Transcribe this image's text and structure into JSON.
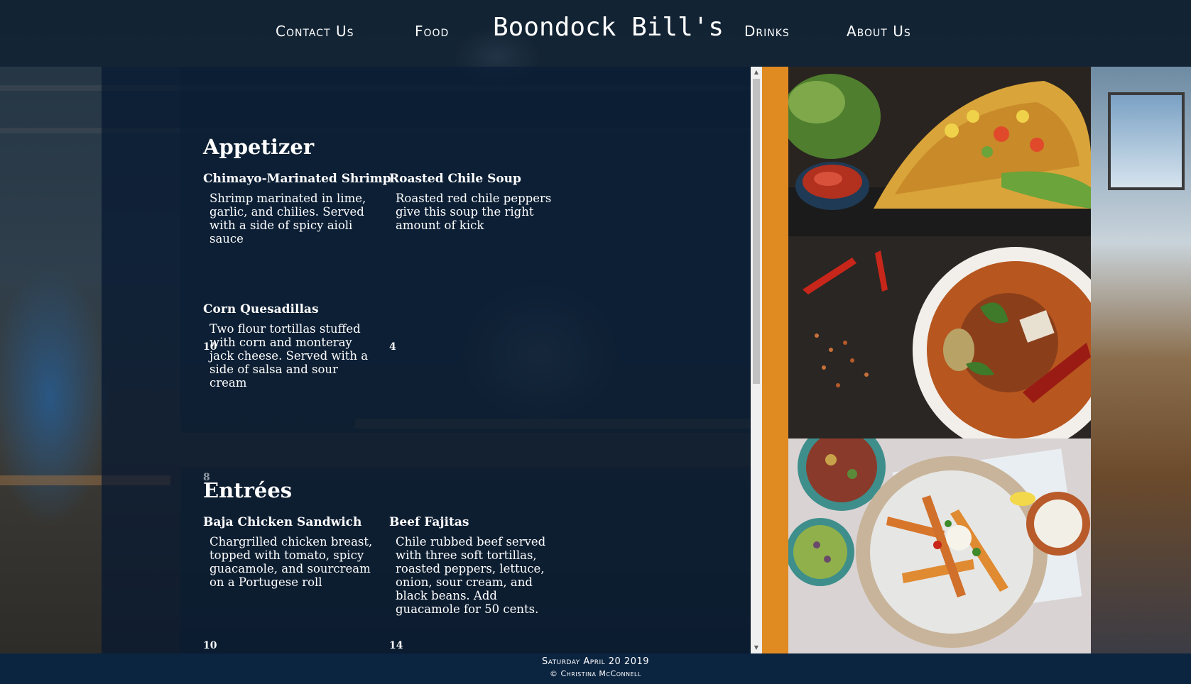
{
  "nav": {
    "contact_label": "Contact Us",
    "food_label": "Food",
    "brand": "Boondock Bill's",
    "drinks_label": "Drinks",
    "about_label": "About Us"
  },
  "menu": {
    "sections": [
      {
        "title": "Appetizer",
        "items": [
          {
            "name": "Chimayo-Marinated Shrimp",
            "description": "Shrimp marinated in lime, garlic, and chilies. Served with a side of spicy aioli sauce",
            "price": "10"
          },
          {
            "name": "Roasted Chile Soup",
            "description": "Roasted red chile peppers give this soup the right amount of kick",
            "price": "4"
          },
          {
            "name": "Corn Quesadillas",
            "description": "Two flour tortillas stuffed with corn and monteray jack cheese. Served with a side of salsa and sour cream",
            "price": "8"
          }
        ]
      },
      {
        "title": "Entrées",
        "items": [
          {
            "name": "Baja Chicken Sandwich",
            "description": "Chargrilled chicken breast, topped with tomato, spicy guacamole, and sourcream on a Portugese roll",
            "price": "10"
          },
          {
            "name": "Beef Fajitas",
            "description": "Chile rubbed beef served with three soft tortillas, roasted peppers, lettuce, onion, sour cream, and black beans. Add guacamole for 50 cents.",
            "price": "14"
          }
        ]
      }
    ]
  },
  "images": [
    {
      "icon": "taco-photo"
    },
    {
      "icon": "curry-soup-photo"
    },
    {
      "icon": "fajita-platter-photo"
    }
  ],
  "colors": {
    "accent": "#e08a22",
    "footer": "#0b2440"
  },
  "footer": {
    "date": "Saturday April 20 2019",
    "credit": "© Christina McConnell"
  }
}
